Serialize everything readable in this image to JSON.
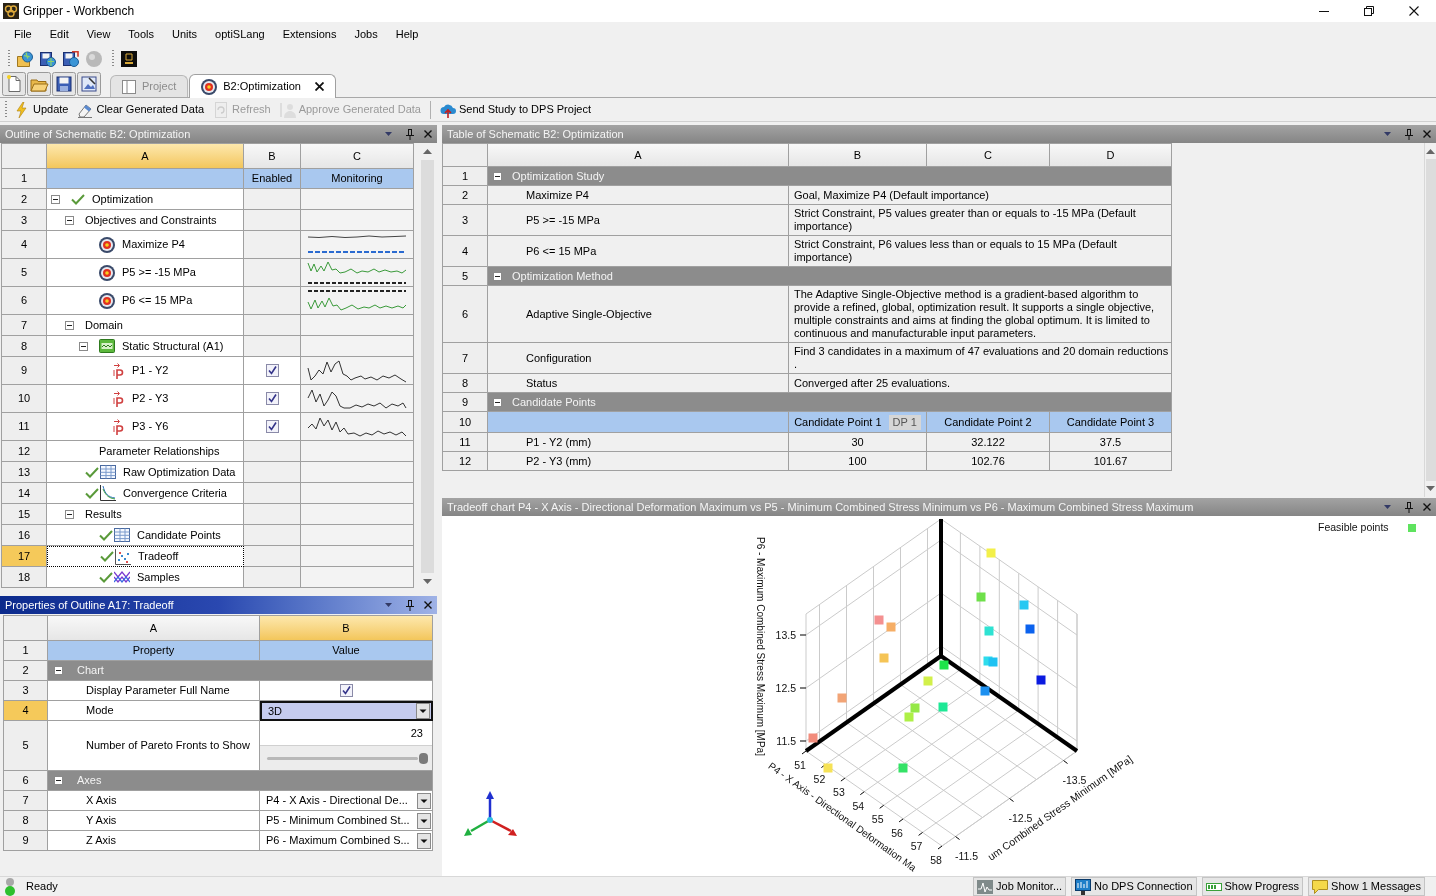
{
  "window": {
    "title": "Gripper - Workbench"
  },
  "menu": [
    "File",
    "Edit",
    "View",
    "Tools",
    "Units",
    "optiSLang",
    "Extensions",
    "Jobs",
    "Help"
  ],
  "tabs": [
    {
      "label": "Project",
      "selected": false
    },
    {
      "label": "B2:Optimization",
      "selected": true
    }
  ],
  "actions": [
    {
      "label": "Update",
      "disabled": false
    },
    {
      "label": "Clear Generated Data",
      "disabled": false
    },
    {
      "label": "Refresh",
      "disabled": true
    },
    {
      "label": "Approve Generated Data",
      "disabled": true
    },
    {
      "label": "Send Study to DPS Project",
      "disabled": false
    }
  ],
  "outline": {
    "title": "Outline of Schematic B2: Optimization",
    "active": false,
    "columns": [
      {
        "label": "A",
        "selected": true
      },
      {
        "label": "B",
        "selected": false
      },
      {
        "label": "C",
        "selected": false
      }
    ],
    "header_row": {
      "row": "1",
      "column_b": "Enabled",
      "column_c": "Monitoring"
    },
    "items": [
      {
        "row": "2",
        "label": "Optimization",
        "kind": "root",
        "up_to_date": true,
        "expanded": true,
        "selected": false,
        "children": [
          {
            "row": "3",
            "label": "Objectives and Constraints",
            "kind": "group",
            "up_to_date": false,
            "expanded": true,
            "selected": false,
            "children": [
              {
                "row": "4",
                "label": "Maximize P4",
                "kind": "objective",
                "up_to_date": false,
                "selected": false
              },
              {
                "row": "5",
                "label": "P5 >= -15 MPa",
                "kind": "objective",
                "up_to_date": false,
                "selected": false
              },
              {
                "row": "6",
                "label": "P6 <= 15 MPa",
                "kind": "objective",
                "up_to_date": false,
                "selected": false
              }
            ]
          },
          {
            "row": "7",
            "label": "Domain",
            "kind": "group",
            "up_to_date": false,
            "expanded": true,
            "selected": false,
            "children": [
              {
                "row": "8",
                "label": "Static Structural (A1)",
                "kind": "system",
                "up_to_date": false,
                "expanded": true,
                "selected": false,
                "children": [
                  {
                    "row": "9",
                    "label": "P1 - Y2",
                    "kind": "input",
                    "up_to_date": false,
                    "enabled": true,
                    "selected": false
                  },
                  {
                    "row": "10",
                    "label": "P2 - Y3",
                    "kind": "input",
                    "up_to_date": false,
                    "enabled": true,
                    "selected": false
                  },
                  {
                    "row": "11",
                    "label": "P3 - Y6",
                    "kind": "input",
                    "up_to_date": false,
                    "enabled": true,
                    "selected": false
                  }
                ]
              },
              {
                "row": "12",
                "label": "Parameter Relationships",
                "kind": "relationships",
                "up_to_date": false,
                "selected": false
              }
            ]
          },
          {
            "row": "13",
            "label": "Raw Optimization Data",
            "kind": "table",
            "up_to_date": true,
            "selected": false
          },
          {
            "row": "14",
            "label": "Convergence Criteria",
            "kind": "convergence",
            "up_to_date": true,
            "selected": false
          },
          {
            "row": "15",
            "label": "Results",
            "kind": "group",
            "up_to_date": false,
            "expanded": true,
            "selected": false,
            "children": [
              {
                "row": "16",
                "label": "Candidate Points",
                "kind": "table",
                "up_to_date": true,
                "selected": false
              },
              {
                "row": "17",
                "label": "Tradeoff",
                "kind": "tradeoff",
                "up_to_date": true,
                "selected": true
              },
              {
                "row": "18",
                "label": "Samples",
                "kind": "samples",
                "up_to_date": true,
                "selected": false
              }
            ]
          }
        ]
      }
    ]
  },
  "properties": {
    "title": "Properties of Outline A17: Tradeoff",
    "active": true,
    "columns": [
      {
        "label": "A",
        "selected": false
      },
      {
        "label": "B",
        "selected": true
      }
    ],
    "header_row": {
      "row": "1",
      "column_a": "Property",
      "column_b": "Value"
    },
    "rows": [
      {
        "row": "2",
        "kind": "group",
        "label": "Chart",
        "expanded": true,
        "selected": false
      },
      {
        "row": "3",
        "kind": "checkbox",
        "label": "Display Parameter Full Name",
        "checked": true,
        "selected": false
      },
      {
        "row": "4",
        "kind": "dropdown",
        "label": "Mode",
        "value": "3D",
        "selected": true
      },
      {
        "row": "5",
        "kind": "slider",
        "label": "Number of Pareto Fronts to Show",
        "value": "23",
        "level": 1,
        "selected": false
      },
      {
        "row": "6",
        "kind": "group",
        "label": "Axes",
        "expanded": true,
        "selected": false
      },
      {
        "row": "7",
        "kind": "dropdown",
        "label": "X Axis",
        "value": "P4 - X Axis - Directional De...",
        "selected": false
      },
      {
        "row": "8",
        "kind": "dropdown",
        "label": "Y Axis",
        "value": "P5 - Minimum Combined St...",
        "selected": false
      },
      {
        "row": "9",
        "kind": "dropdown",
        "label": "Z Axis",
        "value": "P6 - Maximum Combined S...",
        "selected": false
      }
    ]
  },
  "table": {
    "title": "Table of Schematic B2: Optimization",
    "active": false,
    "columns": [
      "A",
      "B",
      "C",
      "D"
    ],
    "rows": [
      {
        "row": "1",
        "kind": "group",
        "label": "Optimization Study",
        "expanded": true
      },
      {
        "row": "2",
        "kind": "detail",
        "label": "Maximize P4",
        "value": "Goal, Maximize P4 (Default importance)"
      },
      {
        "row": "3",
        "kind": "detail",
        "label": "P5 >= -15 MPa",
        "value": "Strict Constraint, P5 values greater than or equals to -15 MPa (Default importance)"
      },
      {
        "row": "4",
        "kind": "detail",
        "label": "P6 <= 15 MPa",
        "value": "Strict Constraint, P6 values less than or equals to 15 MPa (Default importance)"
      },
      {
        "row": "5",
        "kind": "group",
        "label": "Optimization Method",
        "expanded": true
      },
      {
        "row": "6",
        "kind": "detail",
        "label": "Adaptive Single-Objective",
        "value": "The Adaptive Single-Objective method is a gradient-based algorithm to provide a refined, global, optimization result. It supports a single objective, multiple constraints and aims at finding the global optimum. It is limited to continuous and manufacturable input parameters."
      },
      {
        "row": "7",
        "kind": "detail",
        "label": "Configuration",
        "value": "Find 3 candidates in a maximum of 47 evaluations and 20 domain reductions ."
      },
      {
        "row": "8",
        "kind": "detail",
        "label": "Status",
        "value": "Converged after 25 evaluations."
      },
      {
        "row": "9",
        "kind": "group",
        "label": "Candidate Points",
        "expanded": true
      },
      {
        "row": "10",
        "kind": "header",
        "cells": [
          "Candidate Point 1",
          "Candidate Point 2",
          "Candidate Point 3"
        ],
        "tag": "DP 1"
      },
      {
        "row": "11",
        "kind": "values",
        "label": "P1 - Y2 (mm)",
        "cells": [
          "30",
          "32.122",
          "37.5"
        ]
      },
      {
        "row": "12",
        "kind": "values",
        "label": "P2 - Y3 (mm)",
        "cells": [
          "100",
          "102.76",
          "101.67"
        ]
      }
    ]
  },
  "chart": {
    "title": "Tradeoff chart P4 - X Axis - Directional Deformation Maximum vs P5 - Minimum Combined Stress Minimum vs P6 - Maximum Combined Stress Maximum",
    "active": false,
    "legend": "Feasible points",
    "z_axis": {
      "title": "P6 - Maximum Combined Stress Maximum [MPa]",
      "ticks": [
        "13.5",
        "12.5",
        "11.5"
      ]
    },
    "x_axis": {
      "title": "P4 - X Axis - Directional Deformation Ma",
      "ticks": [
        "51",
        "52",
        "53",
        "54",
        "55",
        "56",
        "57",
        "58"
      ]
    },
    "y_axis": {
      "title": "um Combined Stress Minimum [MPa]",
      "ticks": [
        "-13.5",
        "-12.5",
        "-11.5"
      ]
    }
  },
  "status_bar": {
    "text": "Ready",
    "buttons": [
      "Job Monitor...",
      "No DPS Connection",
      "Show Progress",
      "Show 1 Messages"
    ]
  }
}
